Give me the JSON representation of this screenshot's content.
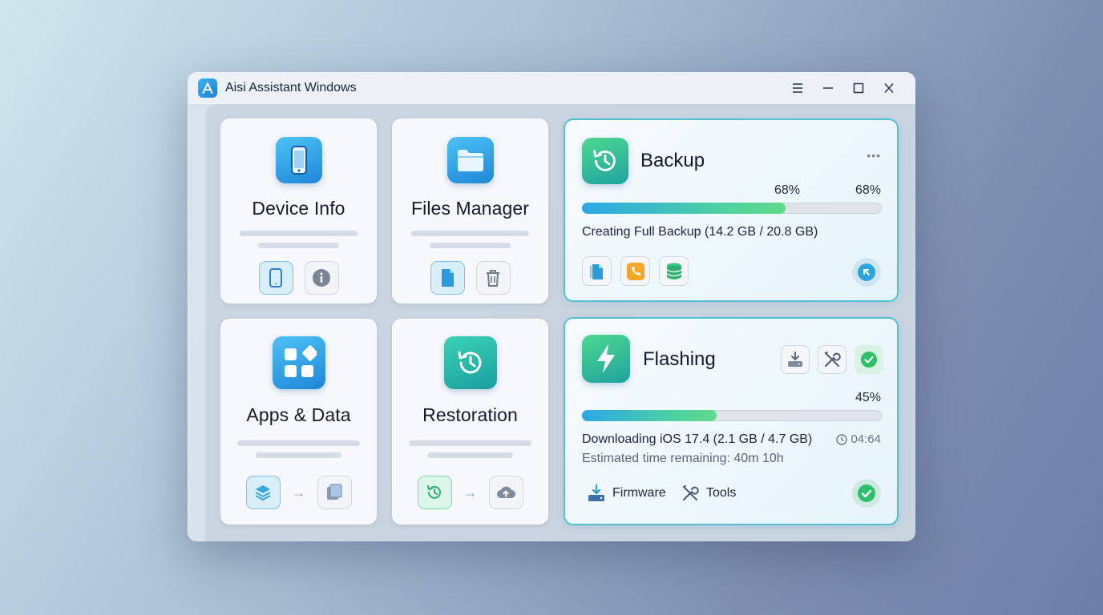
{
  "window": {
    "title": "Aisi Assistant Windows",
    "logo_letter": "A",
    "controls": [
      "menu-icon",
      "minimize-icon",
      "maximize-icon",
      "close-icon"
    ]
  },
  "tiles": {
    "device_info": {
      "title": "Device Info",
      "icon": "phone-icon",
      "actions": [
        "phone-icon",
        "info-icon"
      ]
    },
    "files_manager": {
      "title": "Files Manager",
      "icon": "folder-icon",
      "actions": [
        "file-icon",
        "trash-icon"
      ]
    },
    "apps_data": {
      "title": "Apps & Data",
      "icon": "apps-grid-icon",
      "actions": [
        "layers-icon",
        "arrow-right",
        "copy-icon"
      ]
    },
    "restoration": {
      "title": "Restoration",
      "icon": "history-icon",
      "actions": [
        "history-icon",
        "arrow-right",
        "cloud-upload-icon"
      ]
    }
  },
  "backup": {
    "title": "Backup",
    "progress_label_1": "68%",
    "progress_label_2": "68%",
    "progress": 0.68,
    "status": "Creating Full Backup (14.2 GB / 20.8 GB)",
    "more_label": "•••",
    "actions": [
      "document-icon",
      "phone-call-icon",
      "database-icon",
      "collapse-icon"
    ]
  },
  "flashing": {
    "title": "Flashing",
    "progress_label": "45%",
    "progress": 0.45,
    "status": "Downloading iOS 17.4 (2.1 GB / 4.7 GB)",
    "elapsed": "04:64",
    "remaining": "Estimated time remaining: 40m 10h",
    "header_actions": [
      "download-drive-icon",
      "tools-icon",
      "check-icon"
    ],
    "links": {
      "firmware": "Firmware",
      "tools": "Tools"
    }
  },
  "colors": {
    "accent_blue": "#2aa7e6",
    "accent_green": "#4fd2a0",
    "card_border": "#53c0cf"
  }
}
